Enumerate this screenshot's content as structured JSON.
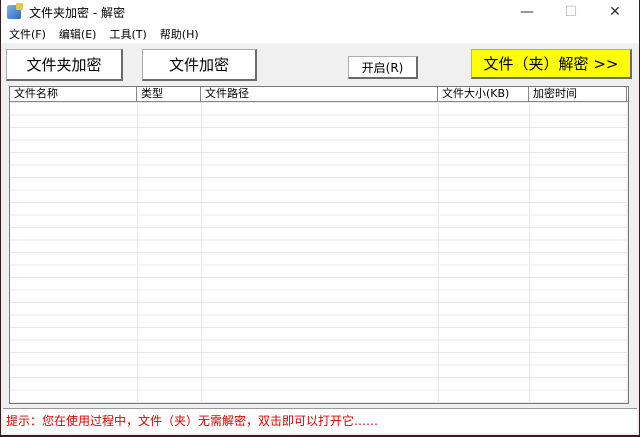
{
  "window": {
    "title": "文件夹加密 - 解密"
  },
  "menu": [
    "文件(F)",
    "编辑(E)",
    "工具(T)",
    "帮助(H)"
  ],
  "toolbar": {
    "folder_encrypt": "文件夹加密",
    "file_encrypt": "文件加密",
    "open": "开启(R)",
    "decrypt": "文件（夹）解密 >>"
  },
  "table": {
    "columns": [
      "文件名称",
      "类型",
      "文件路径",
      "文件大小(KB)",
      "加密时间"
    ],
    "rows": []
  },
  "status": "提示：您在使用过程中，文件（夹）无需解密，双击即可以打开它……",
  "colors": {
    "decrypt_bg": "#ffff00",
    "status_text": "#e00000"
  }
}
